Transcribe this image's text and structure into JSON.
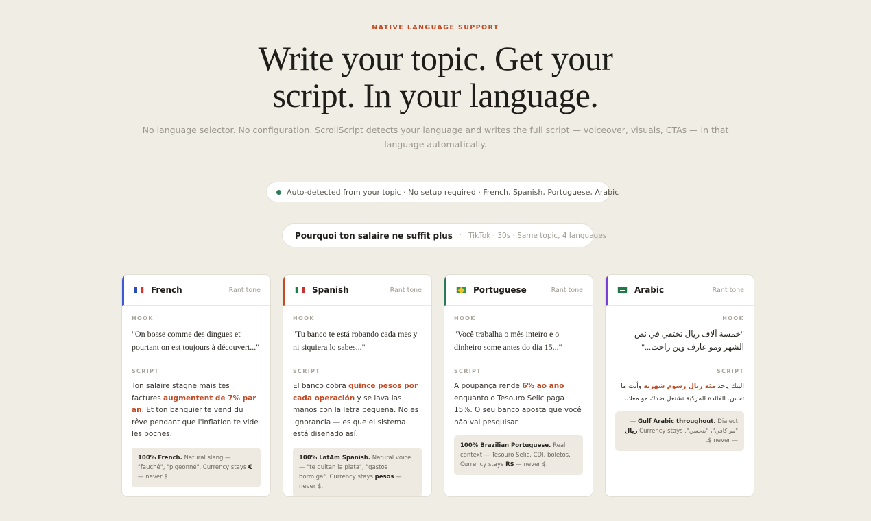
{
  "eyebrow": "NATIVE LANGUAGE SUPPORT",
  "headline": {
    "line1": "Write your topic. Get your",
    "line2": "script. In your language."
  },
  "subtext": "No language selector. No configuration. ScrollScript detects your language and writes the full script — voiceover, visuals, CTAs — in that language automatically.",
  "detect_pill": {
    "text": "Auto-detected from your topic · No setup required · French, Spanish, Portuguese, Arabic",
    "dot_color": "#2b7a55"
  },
  "topic_pill": {
    "title": "Pourquoi ton salaire ne suffit plus",
    "separator": "·",
    "meta": "TikTok · 30s · Same topic, 4 languages"
  },
  "labels": {
    "hook": "HOOK",
    "script": "SCRIPT"
  },
  "cards": [
    {
      "language": "French",
      "tone": "Rant tone",
      "accent": "#3b5bd6",
      "flag_icon": "france-flag-icon",
      "hook": "\"On bosse comme des dingues et pourtant on est toujours à découvert...\"",
      "script_pre": "Ton salaire stagne mais tes factures ",
      "script_hl": "augmentent de 7% par an",
      "script_post": ". Et ton banquier te vend du rêve pendant que l'inflation te vide les poches.",
      "note_bold": "100% French.",
      "note_pre": " Natural slang — \"fauché\", \"pigeonné\". Currency stays ",
      "note_bold2": "€",
      "note_post": " — never $."
    },
    {
      "language": "Spanish",
      "tone": "Rant tone",
      "accent": "#c24a24",
      "flag_icon": "mexico-flag-icon",
      "hook": "\"Tu banco te está robando cada mes y ni siquiera lo sabes...\"",
      "script_pre": "El banco cobra ",
      "script_hl": "quince pesos por cada operación",
      "script_post": " y se lava las manos con la letra pequeña. No es ignorancia — es que el sistema está diseñado así.",
      "note_bold": "100% LatAm Spanish.",
      "note_pre": " Natural voice — \"te quitan la plata\", \"gastos hormiga\". Currency stays ",
      "note_bold2": "pesos",
      "note_post": " — never $."
    },
    {
      "language": "Portuguese",
      "tone": "Rant tone",
      "accent": "#2b7a55",
      "flag_icon": "brazil-flag-icon",
      "hook": "\"Você trabalha o mês inteiro e o dinheiro some antes do dia 15...\"",
      "script_pre": "A poupança rende ",
      "script_hl": "6% ao ano",
      "script_post": " enquanto o Tesouro Selic paga 15%. O seu banco aposta que você não vai pesquisar.",
      "note_bold": "100% Brazilian Portuguese.",
      "note_pre": " Real context — Tesouro Selic, CDI, boletos. Currency stays ",
      "note_bold2": "R$",
      "note_post": " — never $."
    },
    {
      "language": "Arabic",
      "tone": "Rant tone",
      "accent": "#7b3fd6",
      "flag_icon": "saudi-arabia-flag-icon",
      "hook": "\"خمسة آلاف ريال تختفي في نص الشهر ومو عارف وين راحت...\"",
      "script_pre": "البنك ياخذ ",
      "script_hl": "مئة ريال رسوم شهرية",
      "script_post": " وأنت ما تحس. الفائدة المركبة تشتغل ضدك مو معك.",
      "note_bold": "Gulf Arabic throughout.",
      "note_pre": " Dialect — \"مو كافي\"، \"بنحسن\". Currency stays ",
      "note_bold2": "ريال",
      "note_post": " — never $."
    }
  ]
}
